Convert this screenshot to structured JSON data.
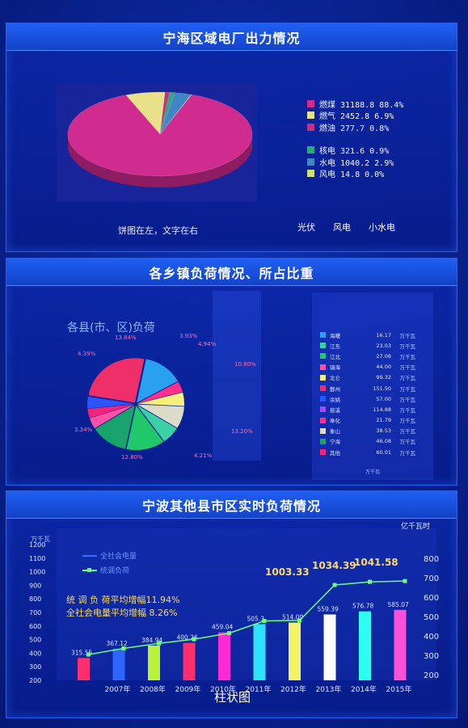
{
  "panel1": {
    "title": "宁海区域电厂出力情况",
    "legend": [
      {
        "name": "燃煤",
        "value": "31188.8",
        "pct": "88.4%",
        "color": "#d02c8f"
      },
      {
        "name": "燃气",
        "value": "2452.8",
        "pct": "6.9%",
        "color": "#e9e08a"
      },
      {
        "name": "燃油",
        "value": "277.7",
        "pct": "0.8%",
        "color": "#c23086"
      },
      {
        "name": "核电",
        "value": "321.6",
        "pct": "0.9%",
        "color": "#2fa780"
      },
      {
        "name": "水电",
        "value": "1040.2",
        "pct": "2.9%",
        "color": "#3e86c6"
      },
      {
        "name": "风电",
        "value": "14.8",
        "pct": "0.0%",
        "color": "#cfe07a"
      }
    ],
    "pie_values": [
      88.4,
      6.9,
      0.8,
      0.9,
      2.9,
      0.1
    ],
    "caption": "饼图在左，文字在右",
    "tabs": [
      "光伏",
      "风电",
      "小水电"
    ]
  },
  "panel2": {
    "title": "各乡镇负荷情况、所占比重",
    "chart_title": "各县(市、区)负荷",
    "pie_values": [
      13.8,
      3.9,
      4.9,
      8.0,
      6.3,
      13.2,
      12.8,
      4.0,
      3.3,
      4.3,
      25.5
    ],
    "pie_colors": [
      "#2aa0f0",
      "#ff2f8a",
      "#f4f07a",
      "#dcdcc8",
      "#3bd0a6",
      "#21c86a",
      "#17a36b",
      "#ff4fa6",
      "#f22479",
      "#2c55ff",
      "#ef2f6a"
    ],
    "slice_labels": [
      "13.84%",
      "3.93%",
      "4.94%",
      "10.80%",
      "13.20%",
      "4.21%",
      "12.80%",
      "3.34%",
      "4.39%"
    ],
    "table_rows": [
      {
        "name": "海曙",
        "value": "16.17",
        "unit": "万千瓦",
        "color": "#2aa0f0"
      },
      {
        "name": "江东",
        "value": "23.03",
        "unit": "万千瓦",
        "color": "#3bd0a6"
      },
      {
        "name": "江北",
        "value": "27.08",
        "unit": "万千瓦",
        "color": "#21c86a"
      },
      {
        "name": "镇海",
        "value": "44.00",
        "unit": "万千瓦",
        "color": "#ff4fa6"
      },
      {
        "name": "北仑",
        "value": "99.32",
        "unit": "万千瓦",
        "color": "#f4f07a"
      },
      {
        "name": "鄞州",
        "value": "151.50",
        "unit": "万千瓦",
        "color": "#ef2f6a"
      },
      {
        "name": "余姚",
        "value": "57.00",
        "unit": "万千瓦",
        "color": "#2c55ff"
      },
      {
        "name": "慈溪",
        "value": "114.88",
        "unit": "万千瓦",
        "color": "#a04cff"
      },
      {
        "name": "奉化",
        "value": "21.79",
        "unit": "万千瓦",
        "color": "#ff2f8a"
      },
      {
        "name": "象山",
        "value": "38.53",
        "unit": "万千瓦",
        "color": "#dcdcc8"
      },
      {
        "name": "宁海",
        "value": "46.08",
        "unit": "万千瓦",
        "color": "#17a36b"
      },
      {
        "name": "其他",
        "value": "60.01",
        "unit": "万千瓦",
        "color": "#f22479"
      }
    ],
    "table_footer": "万千瓦"
  },
  "panel3": {
    "title": "宁波其他县市区实时负荷情况",
    "legend_power": "全社会电量",
    "legend_load": "统调负荷",
    "left_axis_unit": "万千瓦",
    "right_axis_unit": "亿千瓦时",
    "note1": "统 调 负 荷平均增幅11.94%",
    "note2": "全社会电量平均增幅 8.26%",
    "caption": "柱状图"
  },
  "chart_data": {
    "type": "bar",
    "categories": [
      "2007年",
      "2008年",
      "2009年",
      "2010年",
      "2011年",
      "2012年",
      "2013年",
      "2014年",
      "2015年"
    ],
    "series": [
      {
        "name": "全社会电量",
        "values": [
          315.55,
          367.12,
          384.94,
          400.26,
          459.04,
          505.3,
          514.09,
          559.39,
          576.78,
          585.07
        ]
      },
      {
        "name": "统调负荷",
        "values": [
          320,
          380,
          430,
          470,
          530,
          650,
          655,
          1003.33,
          1034.39,
          1041.58
        ]
      }
    ],
    "bar_values": [
      315.55,
      367.12,
      384.94,
      400.26,
      459.04,
      505.3,
      514.09,
      559.39,
      576.78,
      585.07
    ],
    "line_values": [
      320,
      380,
      430,
      470,
      530,
      650,
      655,
      1003.33,
      1034.39,
      1041.58
    ],
    "line_labels": [
      "1003.33",
      "1034.39",
      "1041.58"
    ],
    "left_ticks": [
      "1200",
      "1100",
      "1000",
      "900",
      "800",
      "700",
      "600",
      "500",
      "400",
      "300",
      "200"
    ],
    "right_ticks": [
      "800",
      "700",
      "600",
      "500",
      "400",
      "300",
      "200"
    ],
    "bar_colors": [
      "#ff2e6d",
      "#2e64ff",
      "#b9f23b",
      "#ff2e6d",
      "#ff2ad6",
      "#2ee3ff",
      "#f3f36a",
      "#ffffff",
      "#2efff0",
      "#ff4fd6"
    ]
  }
}
